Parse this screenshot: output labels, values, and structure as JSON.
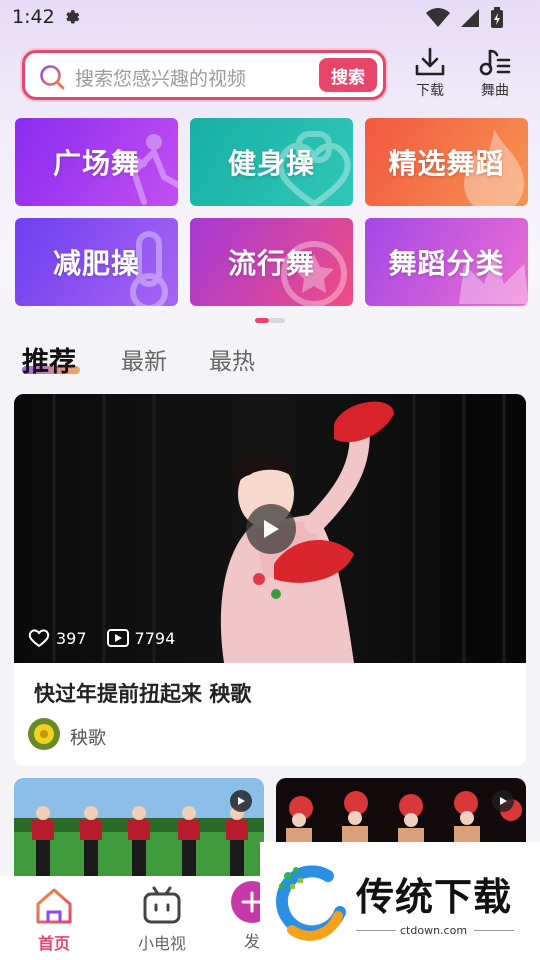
{
  "status_bar": {
    "time": "1:42"
  },
  "search": {
    "placeholder": "搜索您感兴趣的视频",
    "button_label": "搜索"
  },
  "top_actions": [
    {
      "label": "下载",
      "icon": "download-icon"
    },
    {
      "label": "舞曲",
      "icon": "music-list-icon"
    }
  ],
  "categories": [
    {
      "label": "广场舞",
      "color_start": "#8a2cf0",
      "color_end": "#c24ff2"
    },
    {
      "label": "健身操",
      "color_start": "#18b0a3",
      "color_end": "#2fc7b8"
    },
    {
      "label": "精选舞蹈",
      "color_start": "#f3583f",
      "color_end": "#f79452"
    },
    {
      "label": "减肥操",
      "color_start": "#6f3ff0",
      "color_end": "#a865f3"
    },
    {
      "label": "流行舞",
      "color_start": "#a63ad6",
      "color_end": "#ef4d83"
    },
    {
      "label": "舞蹈分类",
      "color_start": "#a347e6",
      "color_end": "#ee6fd2"
    }
  ],
  "tabs": [
    "推荐",
    "最新",
    "最热"
  ],
  "featured_video": {
    "likes": "397",
    "plays": "7794",
    "title": "快过年提前扭起来  秧歌",
    "author": "秧歌"
  },
  "bottom_nav": [
    {
      "label": "首页",
      "icon": "home-icon",
      "active": true
    },
    {
      "label": "小电视",
      "icon": "tv-icon",
      "active": false
    },
    {
      "label": "发",
      "icon": "publish-icon",
      "active": false
    }
  ],
  "watermark": {
    "brand": "传统下载",
    "url": "ctdown.com"
  },
  "colors": {
    "accent": "#e8456a",
    "active_nav": "#e8456a"
  }
}
